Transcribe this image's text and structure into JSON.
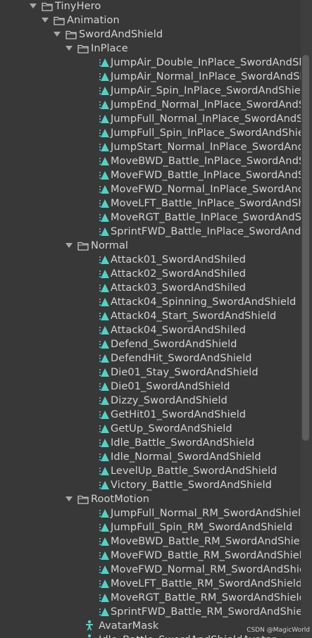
{
  "rows": [
    {
      "label": "TinyHero",
      "type": "folder",
      "depth": 0,
      "expanded": true
    },
    {
      "label": "Animation",
      "type": "folder",
      "depth": 1,
      "expanded": true
    },
    {
      "label": "SwordAndShield",
      "type": "folder",
      "depth": 2,
      "expanded": true
    },
    {
      "label": "InPlace",
      "type": "folder",
      "depth": 3,
      "expanded": true
    },
    {
      "label": "JumpAir_Double_InPlace_SwordAndSh",
      "type": "anim",
      "depth": 4
    },
    {
      "label": "JumpAir_Normal_InPlace_SwordAndSh",
      "type": "anim",
      "depth": 4
    },
    {
      "label": "JumpAir_Spin_InPlace_SwordAndShiel",
      "type": "anim",
      "depth": 4
    },
    {
      "label": "JumpEnd_Normal_InPlace_SwordAndS",
      "type": "anim",
      "depth": 4
    },
    {
      "label": "JumpFull_Normal_InPlace_SwordAndS",
      "type": "anim",
      "depth": 4
    },
    {
      "label": "JumpFull_Spin_InPlace_SwordAndShie",
      "type": "anim",
      "depth": 4
    },
    {
      "label": "JumpStart_Normal_InPlace_SwordAnd",
      "type": "anim",
      "depth": 4
    },
    {
      "label": "MoveBWD_Battle_InPlace_SwordAndS",
      "type": "anim",
      "depth": 4
    },
    {
      "label": "MoveFWD_Battle_InPlace_SwordAndS",
      "type": "anim",
      "depth": 4
    },
    {
      "label": "MoveFWD_Normal_InPlace_SwordAndS",
      "type": "anim",
      "depth": 4
    },
    {
      "label": "MoveLFT_Battle_InPlace_SwordAndSh",
      "type": "anim",
      "depth": 4
    },
    {
      "label": "MoveRGT_Battle_InPlace_SwordAndSh",
      "type": "anim",
      "depth": 4
    },
    {
      "label": "SprintFWD_Battle_InPlace_SwordAndS",
      "type": "anim",
      "depth": 4
    },
    {
      "label": "Normal",
      "type": "folder",
      "depth": 3,
      "expanded": true
    },
    {
      "label": "Attack01_SwordAndShiled",
      "type": "anim",
      "depth": 4
    },
    {
      "label": "Attack02_SwordAndShiled",
      "type": "anim",
      "depth": 4
    },
    {
      "label": "Attack03_SwordAndShiled",
      "type": "anim",
      "depth": 4
    },
    {
      "label": "Attack04_Spinning_SwordAndShield",
      "type": "anim",
      "depth": 4
    },
    {
      "label": "Attack04_Start_SwordAndShield",
      "type": "anim",
      "depth": 4
    },
    {
      "label": "Attack04_SwordAndShiled",
      "type": "anim",
      "depth": 4
    },
    {
      "label": "Defend_SwordAndShield",
      "type": "anim",
      "depth": 4
    },
    {
      "label": "DefendHit_SwordAndShield",
      "type": "anim",
      "depth": 4
    },
    {
      "label": "Die01_Stay_SwordAndShield",
      "type": "anim",
      "depth": 4
    },
    {
      "label": "Die01_SwordAndShield",
      "type": "anim",
      "depth": 4
    },
    {
      "label": "Dizzy_SwordAndShield",
      "type": "anim",
      "depth": 4
    },
    {
      "label": "GetHit01_SwordAndShield",
      "type": "anim",
      "depth": 4
    },
    {
      "label": "GetUp_SwordAndShield",
      "type": "anim",
      "depth": 4
    },
    {
      "label": "Idle_Battle_SwordAndShield",
      "type": "anim",
      "depth": 4
    },
    {
      "label": "Idle_Normal_SwordAndShield",
      "type": "anim",
      "depth": 4
    },
    {
      "label": "LevelUp_Battle_SwordAndShield",
      "type": "anim",
      "depth": 4
    },
    {
      "label": "Victory_Battle_SwordAndShield",
      "type": "anim",
      "depth": 4
    },
    {
      "label": "RootMotion",
      "type": "folder",
      "depth": 3,
      "expanded": true
    },
    {
      "label": "JumpFull_Normal_RM_SwordAndShielc",
      "type": "anim",
      "depth": 4
    },
    {
      "label": "JumpFull_Spin_RM_SwordAndShield",
      "type": "anim",
      "depth": 4
    },
    {
      "label": "MoveBWD_Battle_RM_SwordAndShielc",
      "type": "anim",
      "depth": 4
    },
    {
      "label": "MoveFWD_Battle_RM_SwordAndShielc",
      "type": "anim",
      "depth": 4
    },
    {
      "label": "MoveFWD_Normal_RM_SwordAndShie",
      "type": "anim",
      "depth": 4
    },
    {
      "label": "MoveLFT_Battle_RM_SwordAndShield",
      "type": "anim",
      "depth": 4
    },
    {
      "label": "MoveRGT_Battle_RM_SwordAndShield",
      "type": "anim",
      "depth": 4
    },
    {
      "label": "SprintFWD_Battle_RM_SwordAndShielc",
      "type": "anim",
      "depth": 4
    },
    {
      "label": "AvatarMask",
      "type": "mask",
      "depth": 3
    },
    {
      "label": "Idle_Battle_SwordAndShieldAvatar",
      "type": "mask",
      "depth": 3
    }
  ],
  "watermark": "CSDN @MagicWorld",
  "colors": {
    "background": "#383838",
    "text": "#d4d4d4",
    "anim_icon": "#4fd3c4",
    "mask_icon": "#4fd3c4",
    "folder_icon": "#c8c8c8"
  }
}
